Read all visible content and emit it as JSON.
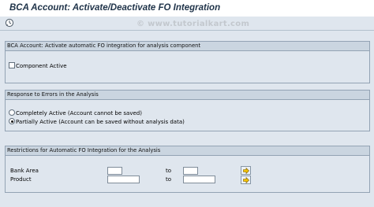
{
  "window": {
    "title": "BCA Account: Activate/Deactivate FO Integration"
  },
  "toolbar": {
    "execute_icon": "execute-clock-icon"
  },
  "watermark": "© www.tutorialkart.com",
  "section_component": {
    "header": "BCA Account: Activate automatic FO integration for analysis component",
    "checkbox_label": "Component Active",
    "checkbox_checked": false
  },
  "section_errors": {
    "header": "Response to Errors in the Analysis",
    "options": [
      {
        "label": "Completely Active (Account cannot be saved)",
        "selected": false
      },
      {
        "label": "Partially Active (Account can be saved without analysis data)",
        "selected": true
      }
    ]
  },
  "section_restrictions": {
    "header": "Restrictions for Automatic FO Integration for the Analysis",
    "to_label": "to",
    "multi_select_icon": "multiple-selection-arrow-icon",
    "fields": [
      {
        "label": "Bank Area",
        "from_value": "",
        "to_value": ""
      },
      {
        "label": "Product",
        "from_value": "",
        "to_value": ""
      }
    ]
  }
}
